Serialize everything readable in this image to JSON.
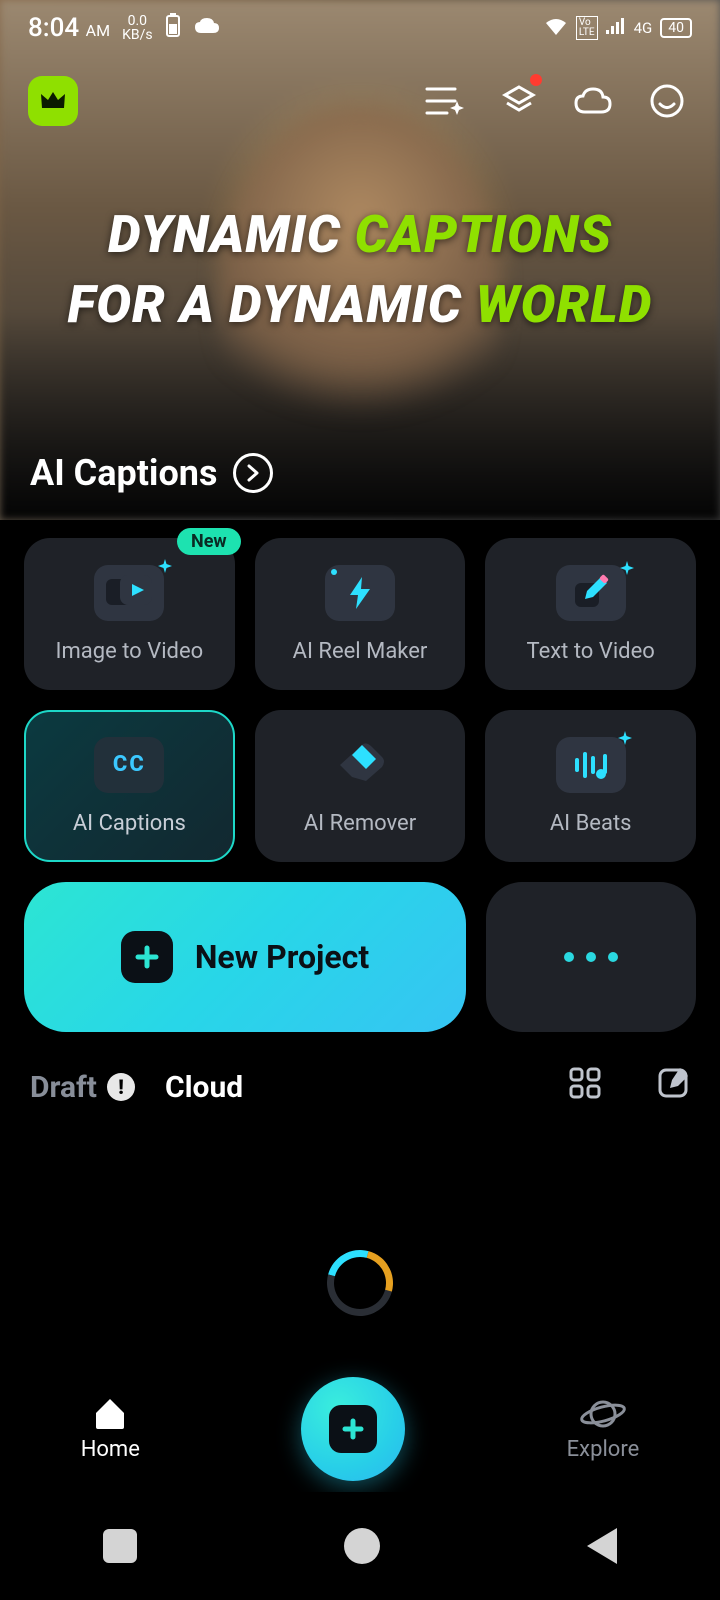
{
  "status": {
    "time": "8:04",
    "ampm": "AM",
    "kbs_top": "0.0",
    "kbs_bot": "KB/s",
    "network": "4G",
    "battery": "40"
  },
  "hero": {
    "line1_a": "DYNAMIC",
    "line1_b": "CAPTIONS",
    "line2_a": "FOR A DYNAMIC",
    "line2_b": "WORLD",
    "feature_label": "AI Captions"
  },
  "tools": [
    {
      "label": "Image to Video",
      "badge": "New",
      "icon": "image-video-icon"
    },
    {
      "label": "AI Reel Maker",
      "badge": null,
      "icon": "bolt-icon"
    },
    {
      "label": "Text to Video",
      "badge": null,
      "icon": "pencil-icon"
    },
    {
      "label": "AI Captions",
      "badge": null,
      "icon": "cc-icon",
      "highlight": true
    },
    {
      "label": "AI Remover",
      "badge": null,
      "icon": "eraser-icon"
    },
    {
      "label": "AI Beats",
      "badge": null,
      "icon": "waveform-icon"
    }
  ],
  "actions": {
    "new_project": "New Project"
  },
  "tabs": {
    "draft": "Draft",
    "cloud": "Cloud"
  },
  "nav": {
    "home": "Home",
    "explore": "Explore"
  }
}
